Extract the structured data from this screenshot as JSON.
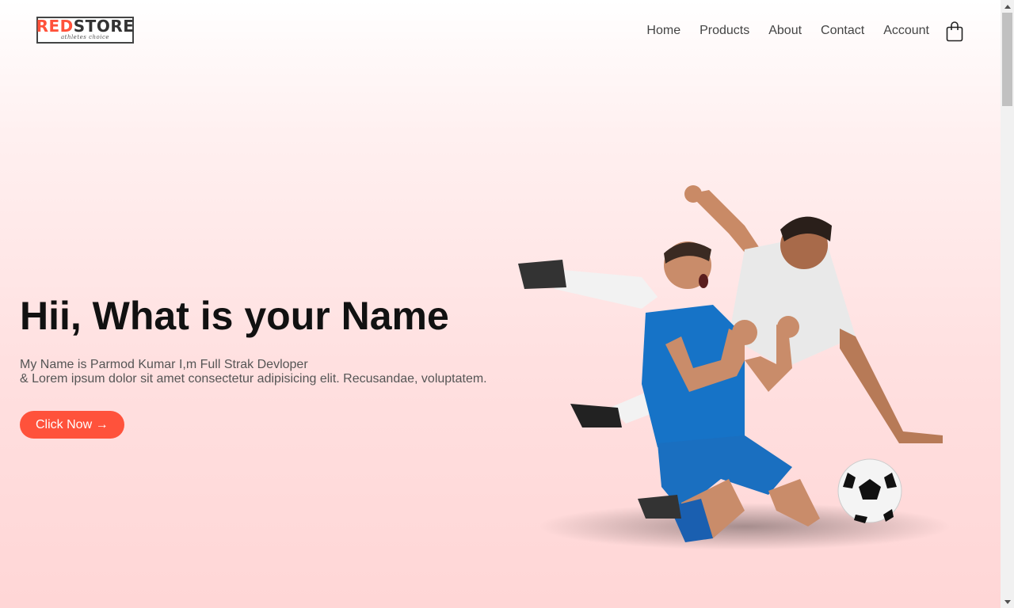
{
  "logo": {
    "word_red": "RED",
    "word_dark": "STORE",
    "tagline": "athletes choice"
  },
  "nav": {
    "items": [
      "Home",
      "Products",
      "About",
      "Contact",
      "Account"
    ],
    "cart_icon": "shopping-bag-icon"
  },
  "hero": {
    "title": "Hii, What is your Name",
    "line1": "My Name is Parmod Kumar I,m Full Strak Devloper",
    "line2": "& Lorem ipsum dolor sit amet consectetur adipisicing elit. Recusandae, voluptatem.",
    "button_label": "Click Now →"
  },
  "colors": {
    "accent": "#ff523b",
    "bg_bottom": "#ffd6d6",
    "text": "#111111"
  }
}
